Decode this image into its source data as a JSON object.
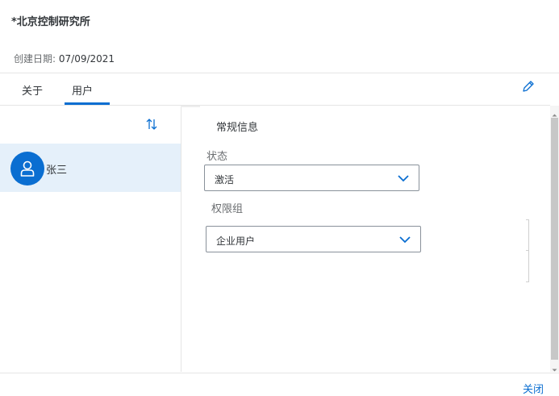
{
  "header": {
    "title": "*北京控制研究所",
    "created_label": "创建日期:",
    "created_value": "07/09/2021"
  },
  "tabs": [
    {
      "label": "关于",
      "selected": false
    },
    {
      "label": "用户",
      "selected": true
    }
  ],
  "master_list": {
    "items": [
      {
        "name": "张三",
        "selected": true
      }
    ]
  },
  "detail": {
    "section_title": "常规信息",
    "status": {
      "label": "状态",
      "value": "激活"
    },
    "permission_group": {
      "label": "权限组",
      "value": "企业用户"
    }
  },
  "footer": {
    "close_label": "关闭"
  },
  "colors": {
    "accent": "#0a6ed1",
    "selected_row": "#e5f0fa",
    "text": "#32363a",
    "label": "#6a6d70"
  },
  "icons": {
    "edit": "pencil-icon",
    "sort": "sort-icon",
    "avatar": "person-icon",
    "dropdown": "chevron-down-icon"
  }
}
